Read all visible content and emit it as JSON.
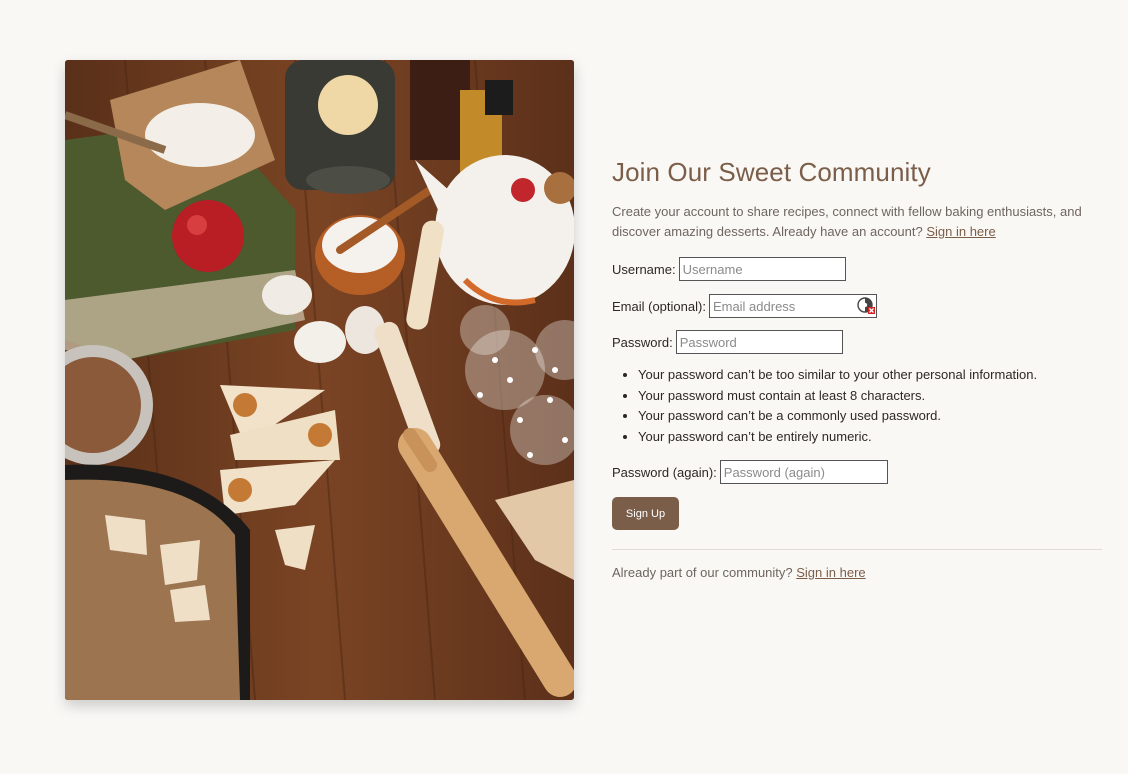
{
  "signup": {
    "title": "Join Our Sweet Community",
    "intro_text": "Create your account to share recipes, connect with fellow baking enthusiasts, and discover amazing desserts. Already have an account? ",
    "intro_link": "Sign in here",
    "username": {
      "label": "Username:",
      "placeholder": "Username",
      "value": ""
    },
    "email": {
      "label": "Email (optional):",
      "placeholder": "Email address",
      "value": "",
      "icon": "password-manager-icon"
    },
    "password": {
      "label": "Password:",
      "placeholder": "Password",
      "value": ""
    },
    "password_rules": [
      "Your password can’t be too similar to your other personal information.",
      "Your password must contain at least 8 characters.",
      "Your password can’t be a commonly used password.",
      "Your password can’t be entirely numeric."
    ],
    "password_again": {
      "label": "Password (again):",
      "placeholder": "Password (again)",
      "value": ""
    },
    "submit_label": "Sign Up",
    "footer_text": "Already part of our community? ",
    "footer_link": "Sign in here"
  },
  "colors": {
    "background": "#faf8f5",
    "accent": "#7b5e49",
    "text": "#2e2824",
    "muted": "#6e655f"
  }
}
